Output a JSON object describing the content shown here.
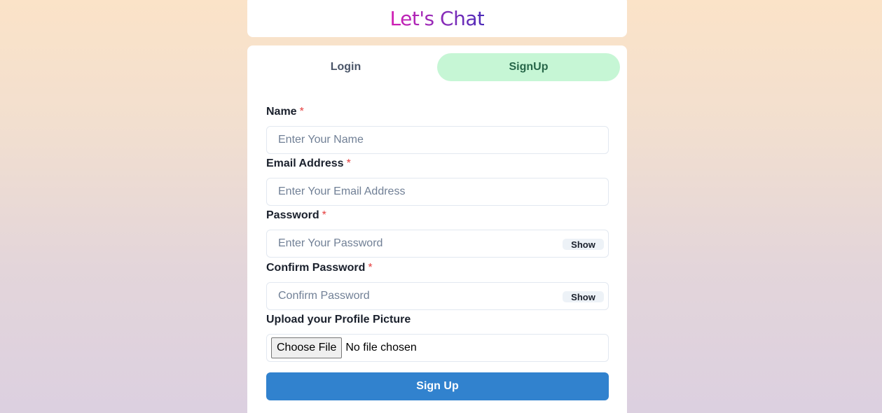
{
  "app": {
    "title": "Let's Chat"
  },
  "tabs": [
    {
      "label": "Login",
      "active": false
    },
    {
      "label": "SignUp",
      "active": true
    }
  ],
  "form": {
    "name": {
      "label": "Name",
      "required_mark": "*",
      "placeholder": "Enter Your Name",
      "value": ""
    },
    "email": {
      "label": "Email Address",
      "required_mark": "*",
      "placeholder": "Enter Your Email Address",
      "value": ""
    },
    "password": {
      "label": "Password",
      "required_mark": "*",
      "placeholder": "Enter Your Password",
      "value": "",
      "toggle_label": "Show"
    },
    "confirm_password": {
      "label": "Confirm Password",
      "required_mark": "*",
      "placeholder": "Confirm Password",
      "value": "",
      "toggle_label": "Show"
    },
    "picture": {
      "label": "Upload your Profile Picture",
      "button_label": "Choose File",
      "status": "No file chosen"
    },
    "submit_label": "Sign Up"
  },
  "colors": {
    "accent": "#3182ce",
    "active_tab_bg": "#c6f6d5",
    "required": "#e53e3e"
  }
}
